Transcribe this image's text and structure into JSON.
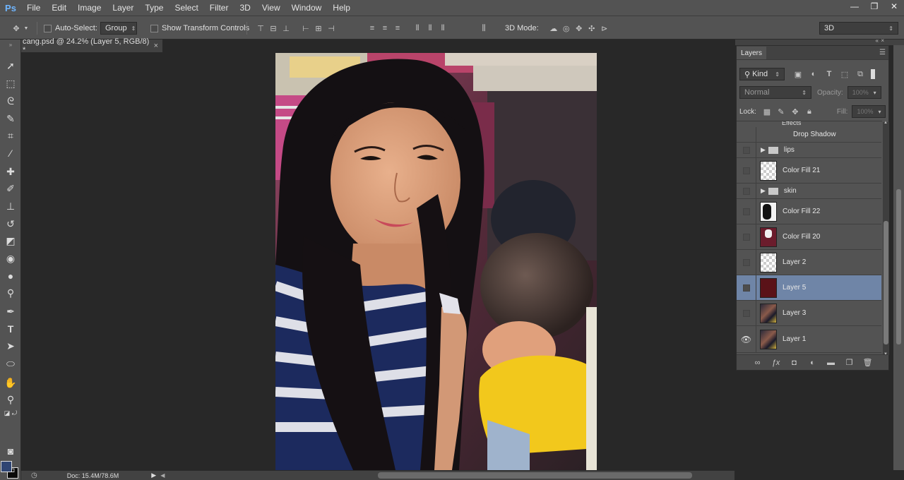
{
  "app": {
    "logo": "Ps",
    "menu": [
      "File",
      "Edit",
      "Image",
      "Layer",
      "Type",
      "Select",
      "Filter",
      "3D",
      "View",
      "Window",
      "Help"
    ],
    "window_controls": [
      "—",
      "❐",
      "✕"
    ]
  },
  "options_bar": {
    "auto_select_label": "Auto-Select:",
    "auto_select_target": "Group",
    "show_transform_label": "Show Transform Controls",
    "mode_3d_label": "3D Mode:",
    "workspace": "3D"
  },
  "document": {
    "tab_title": "cang.psd @ 24.2% (Layer 5, RGB/8) *",
    "close": "×"
  },
  "status": {
    "doc_size": "Doc: 15.4M/78.6M"
  },
  "layers_panel": {
    "title": "Layers",
    "filter_kind": "Kind",
    "blend_mode": "Normal",
    "opacity_label": "Opacity:",
    "opacity_value": "100%",
    "lock_label": "Lock:",
    "fill_label": "Fill:",
    "fill_value": "100%",
    "effects_label": "Effects",
    "drop_shadow_label": "Drop Shadow",
    "layers": [
      {
        "name": "lips",
        "kind": "group",
        "visible": false
      },
      {
        "name": "Color Fill 21",
        "kind": "fill",
        "visible": false
      },
      {
        "name": "skin",
        "kind": "group",
        "visible": false
      },
      {
        "name": "Color Fill 22",
        "kind": "fill-mask",
        "visible": false
      },
      {
        "name": "Color Fill 20",
        "kind": "fill-dark",
        "visible": false
      },
      {
        "name": "Layer 2",
        "kind": "transparent",
        "visible": false
      },
      {
        "name": "Layer 5",
        "kind": "solid",
        "visible": false,
        "selected": true
      },
      {
        "name": "Layer 3",
        "kind": "photo",
        "visible": false
      },
      {
        "name": "Layer 1",
        "kind": "photo",
        "visible": true
      }
    ]
  },
  "colors": {
    "foreground": "#2f4573",
    "background": "#0a0a0a",
    "selection": "#6f85a7",
    "layer5_fill": "#5a1218"
  }
}
